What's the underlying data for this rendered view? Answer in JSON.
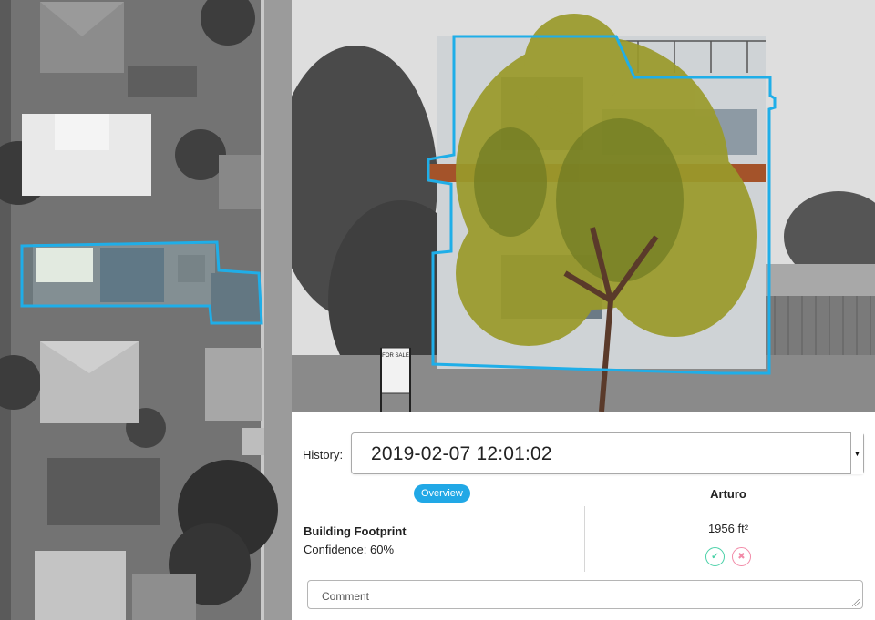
{
  "aerial_view": {
    "footprint_color": "#1faee8"
  },
  "street_view": {
    "outline_color": "#1faee8",
    "sign_text": "FOR SALE"
  },
  "history": {
    "label": "History:",
    "selected": "2019-02-07 12:01:02",
    "arrow_icon": "caret-down-icon"
  },
  "review": {
    "tab_label": "Overview",
    "reviewer": "Arturo",
    "feature_title": "Building Footprint",
    "confidence_text": "Confidence: 60%",
    "area_text": "1956 ft²",
    "accept_glyph": "✔",
    "reject_glyph": "✖",
    "accent_color": "#21a8e6",
    "accept_color": "#4ad1a8",
    "reject_color": "#f28ba8"
  },
  "comment": {
    "placeholder": "Comment"
  }
}
